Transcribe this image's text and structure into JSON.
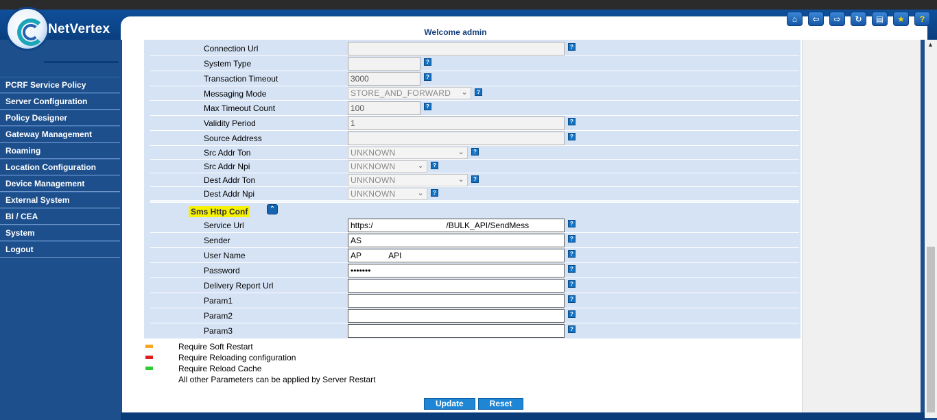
{
  "brand": {
    "name": "NetVertex"
  },
  "header": {
    "welcome": "Welcome admin"
  },
  "toolbar": [
    {
      "name": "home-icon",
      "glyph": "⌂"
    },
    {
      "name": "back-icon",
      "glyph": "⇦"
    },
    {
      "name": "forward-icon",
      "glyph": "⇨"
    },
    {
      "name": "refresh-icon",
      "glyph": "↻"
    },
    {
      "name": "print-icon",
      "glyph": "▤"
    },
    {
      "name": "favorite-icon",
      "glyph": "★"
    },
    {
      "name": "help-icon",
      "glyph": "?"
    }
  ],
  "sidebar": {
    "items": [
      {
        "label": "PCRF Service Policy"
      },
      {
        "label": "Server Configuration"
      },
      {
        "label": "Policy Designer"
      },
      {
        "label": "Gateway Management"
      },
      {
        "label": "Roaming"
      },
      {
        "label": "Location Configuration"
      },
      {
        "label": "Device Management"
      },
      {
        "label": "External System"
      },
      {
        "label": "BI / CEA"
      },
      {
        "label": "System"
      },
      {
        "label": "Logout"
      }
    ]
  },
  "smpp": {
    "connection_url": {
      "label": "Connection Url",
      "value": ""
    },
    "system_type": {
      "label": "System Type",
      "value": ""
    },
    "transaction_timeout": {
      "label": "Transaction Timeout",
      "value": "3000"
    },
    "messaging_mode": {
      "label": "Messaging Mode",
      "value": "STORE_AND_FORWARD"
    },
    "max_timeout_count": {
      "label": "Max Timeout Count",
      "value": "100"
    },
    "validity_period": {
      "label": "Validity Period",
      "value": "1"
    },
    "source_address": {
      "label": "Source Address",
      "value": ""
    },
    "src_addr_ton": {
      "label": "Src Addr Ton",
      "value": "UNKNOWN"
    },
    "src_addr_npi": {
      "label": "Src Addr Npi",
      "value": "UNKNOWN"
    },
    "dest_addr_ton": {
      "label": "Dest Addr Ton",
      "value": "UNKNOWN"
    },
    "dest_addr_npi": {
      "label": "Dest Addr Npi",
      "value": "UNKNOWN"
    }
  },
  "sms_http": {
    "title": "Sms Http Conf",
    "service_url": {
      "label": "Service Url",
      "value": "https:/                                /BULK_API/SendMess"
    },
    "sender": {
      "label": "Sender",
      "value": "AS"
    },
    "user_name": {
      "label": "User Name",
      "value": "AP            API"
    },
    "password": {
      "label": "Password",
      "value": "•••••••"
    },
    "delivery_report_url": {
      "label": "Delivery Report Url",
      "value": ""
    },
    "param1": {
      "label": "Param1",
      "value": ""
    },
    "param2": {
      "label": "Param2",
      "value": ""
    },
    "param3": {
      "label": "Param3",
      "value": ""
    }
  },
  "legend": [
    {
      "text": "Require Soft Restart",
      "color": "#f5a623"
    },
    {
      "text": "Require Reloading configuration",
      "color": "#e02020"
    },
    {
      "text": "Require Reload Cache",
      "color": "#2ecc2e"
    },
    {
      "text": "All other Parameters can be applied by Server Restart",
      "color": ""
    }
  ],
  "buttons": {
    "update": "Update",
    "reset": "Reset"
  }
}
